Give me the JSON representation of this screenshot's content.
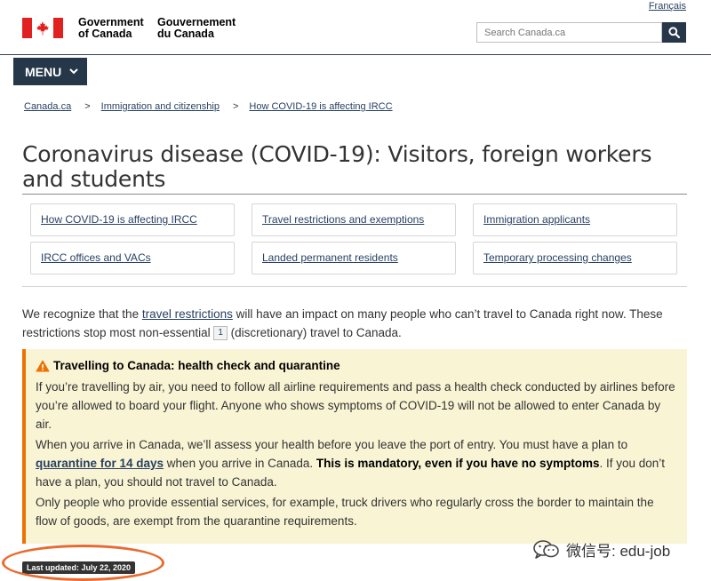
{
  "header": {
    "lang_toggle": "Français",
    "wordmark_en_line1": "Government",
    "wordmark_en_line2": "of Canada",
    "wordmark_fr_line1": "Gouvernement",
    "wordmark_fr_line2": "du Canada",
    "search_placeholder": "Search Canada.ca"
  },
  "menu": {
    "label": "MENU"
  },
  "breadcrumb": [
    {
      "label": "Canada.ca"
    },
    {
      "label": "Immigration and citizenship"
    },
    {
      "label": "How COVID-19 is affecting IRCC"
    }
  ],
  "breadcrumb_sep": ">",
  "page_title": "Coronavirus disease (COVID-19): Visitors, foreign workers and students",
  "tiles": [
    {
      "label": "How COVID-19 is affecting IRCC"
    },
    {
      "label": "Travel restrictions and exemptions"
    },
    {
      "label": "Immigration applicants"
    },
    {
      "label": "IRCC offices and VACs"
    },
    {
      "label": "Landed permanent residents"
    },
    {
      "label": "Temporary processing changes"
    }
  ],
  "intro": {
    "part1": "We recognize that the ",
    "link": "travel restrictions",
    "part2": " will have an impact on many people who can’t travel to Canada right now. These restrictions stop most non-essential",
    "footnote": "1",
    "part3": " (discretionary) travel to Canada."
  },
  "alert": {
    "heading": "Travelling to Canada: health check and quarantine",
    "p1": "If you’re travelling by air, you need to follow all airline requirements and pass a health check conducted by airlines before you’re allowed to board your flight. Anyone who shows symptoms of COVID-19 will not be allowed to enter Canada by air.",
    "p2_a": "When you arrive in Canada, we’ll assess your health before you leave the port of entry. You must have a plan to ",
    "p2_link": "quarantine for 14 days",
    "p2_b": " when you arrive in Canada. ",
    "p2_strong": "This is mandatory, even if you have no symptoms",
    "p2_c": ". If you don’t have a plan, you should not travel to Canada.",
    "p3": "Only people who provide essential services, for example, truck drivers who regularly cross the border to maintain the flow of goods, are exempt from the quarantine requirements."
  },
  "last_updated": "Last updated: July 22, 2020",
  "watermark": "微信号: edu-job",
  "colors": {
    "brand_navy": "#26374a",
    "link": "#284162",
    "flag_red": "#e1211f",
    "alert_bg": "#f9f4d4",
    "alert_border": "#ee7100",
    "highlight_oval": "#ea6a2c"
  },
  "icons": {
    "search": "search-icon",
    "menu": "chevron-down-icon",
    "alert": "warning-triangle-icon",
    "wechat": "wechat-icon"
  }
}
